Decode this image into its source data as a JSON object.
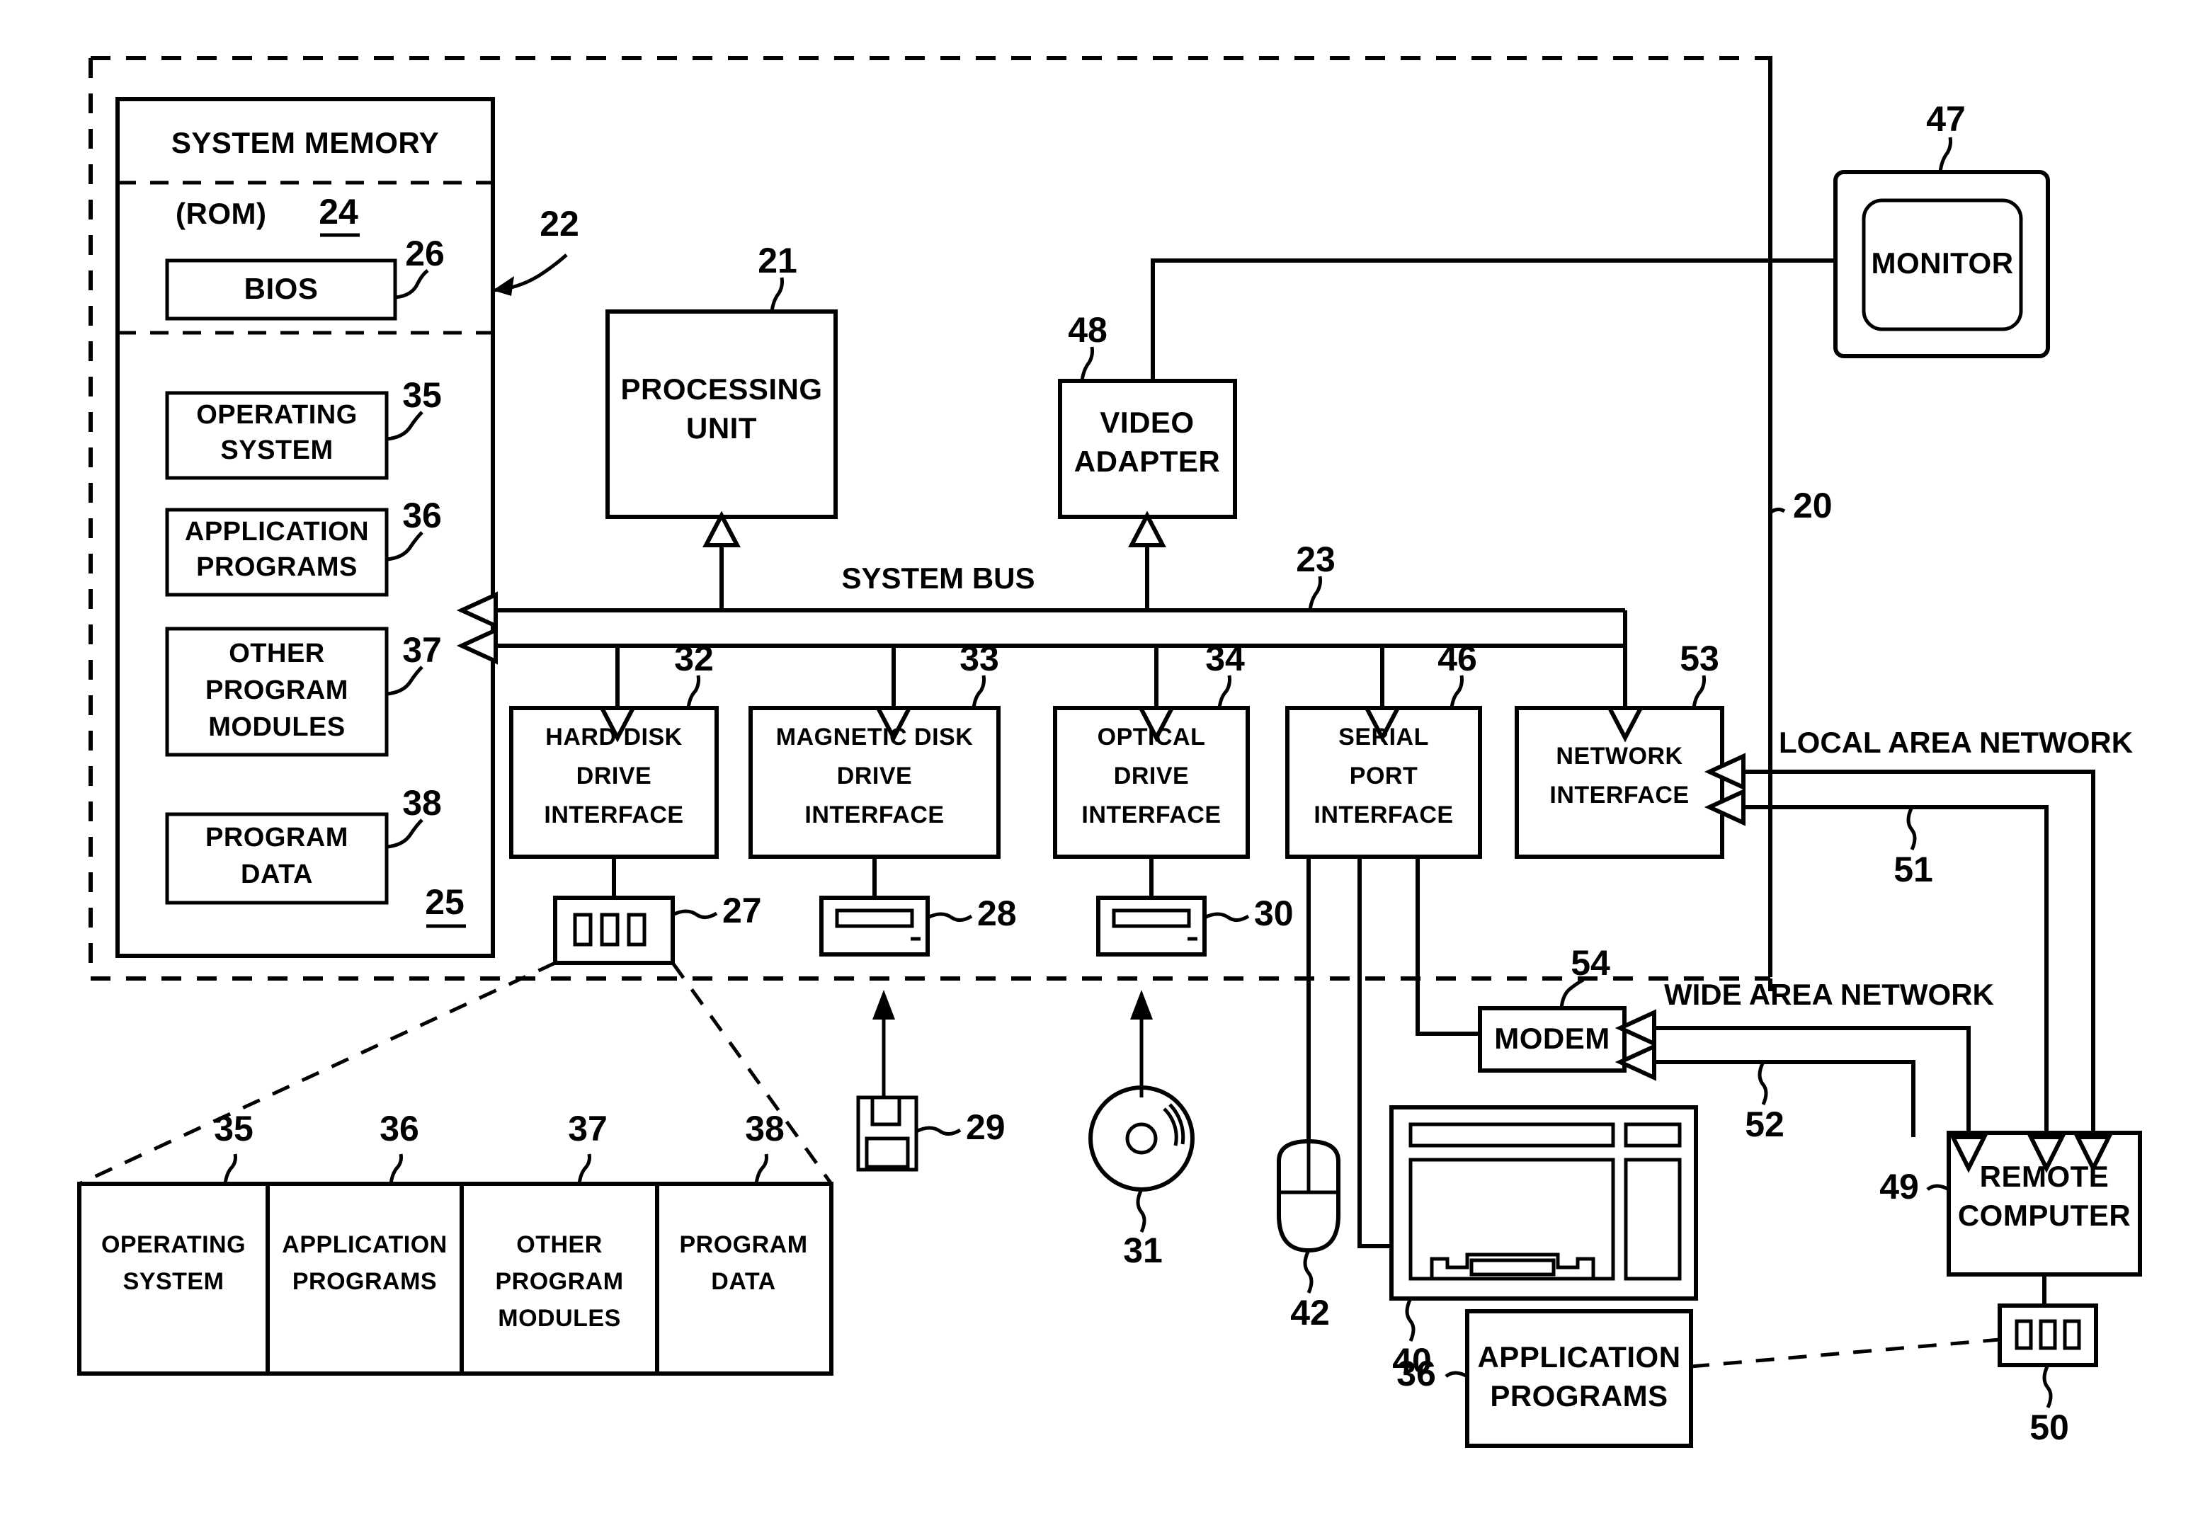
{
  "figure": {
    "type": "patent-block-diagram",
    "title": "Computer system block diagram",
    "system_ref": "20"
  },
  "boxes": {
    "system_memory": {
      "label": "SYSTEM MEMORY",
      "ref": "22"
    },
    "rom": {
      "label": "(ROM)",
      "ref": "24"
    },
    "bios": {
      "label": "BIOS",
      "ref": "26"
    },
    "ram_ref": "25",
    "operating_system": {
      "label_line1": "OPERATING",
      "label_line2": "SYSTEM",
      "ref": "35"
    },
    "application_programs": {
      "label_line1": "APPLICATION",
      "label_line2": "PROGRAMS",
      "ref": "36"
    },
    "other_program_modules": {
      "label_line1": "OTHER",
      "label_line2": "PROGRAM",
      "label_line3": "MODULES",
      "ref": "37"
    },
    "program_data": {
      "label_line1": "PROGRAM",
      "label_line2": "DATA",
      "ref": "38"
    },
    "processing_unit": {
      "label_line1": "PROCESSING",
      "label_line2": "UNIT",
      "ref": "21"
    },
    "video_adapter": {
      "label_line1": "VIDEO",
      "label_line2": "ADAPTER",
      "ref": "48"
    },
    "monitor": {
      "label": "MONITOR",
      "ref": "47"
    },
    "hard_disk_drive_interface": {
      "label_line1": "HARD DISK",
      "label_line2": "DRIVE",
      "label_line3": "INTERFACE",
      "ref": "32"
    },
    "magnetic_disk_drive_interface": {
      "label_line1": "MAGNETIC DISK",
      "label_line2": "DRIVE",
      "label_line3": "INTERFACE",
      "ref": "33"
    },
    "optical_drive_interface": {
      "label_line1": "OPTICAL",
      "label_line2": "DRIVE",
      "label_line3": "INTERFACE",
      "ref": "34"
    },
    "serial_port_interface": {
      "label_line1": "SERIAL",
      "label_line2": "PORT",
      "label_line3": "INTERFACE",
      "ref": "46"
    },
    "network_interface": {
      "label_line1": "NETWORK",
      "label_line2": "INTERFACE",
      "ref": "53"
    },
    "modem": {
      "label": "MODEM",
      "ref": "54"
    },
    "remote_computer": {
      "label_line1": "REMOTE",
      "label_line2": "COMPUTER",
      "ref": "49"
    },
    "remote_application_programs": {
      "label_line1": "APPLICATION",
      "label_line2": "PROGRAMS",
      "ref": "36"
    }
  },
  "bus": {
    "label": "SYSTEM BUS",
    "ref": "23"
  },
  "networks": {
    "lan": {
      "label": "LOCAL AREA NETWORK",
      "ref": "51"
    },
    "wan": {
      "label": "WIDE AREA NETWORK",
      "ref": "52"
    }
  },
  "devices": {
    "hard_disk_drive": {
      "icon": "hard-disk-drive-icon",
      "ref": "27"
    },
    "magnetic_disk_drive": {
      "icon": "magnetic-disk-drive-icon",
      "ref": "28"
    },
    "optical_drive": {
      "icon": "optical-drive-icon",
      "ref": "30"
    },
    "floppy_disk": {
      "icon": "floppy-disk-icon",
      "ref": "29"
    },
    "optical_disc": {
      "icon": "optical-disc-icon",
      "ref": "31"
    },
    "mouse": {
      "icon": "mouse-icon",
      "ref": "42"
    },
    "keyboard": {
      "icon": "keyboard-icon",
      "ref": "40"
    },
    "remote_hard_disk": {
      "icon": "remote-hard-disk-icon",
      "ref": "50"
    }
  },
  "storage_breakout": {
    "cells": [
      {
        "label_line1": "OPERATING",
        "label_line2": "SYSTEM",
        "ref": "35"
      },
      {
        "label_line1": "APPLICATION",
        "label_line2": "PROGRAMS",
        "ref": "36"
      },
      {
        "label_line1": "OTHER",
        "label_line2": "PROGRAM",
        "label_line3": "MODULES",
        "ref": "37"
      },
      {
        "label_line1": "PROGRAM",
        "label_line2": "DATA",
        "ref": "38"
      }
    ]
  },
  "colors": {
    "ink": "#000000",
    "paper": "#ffffff"
  }
}
